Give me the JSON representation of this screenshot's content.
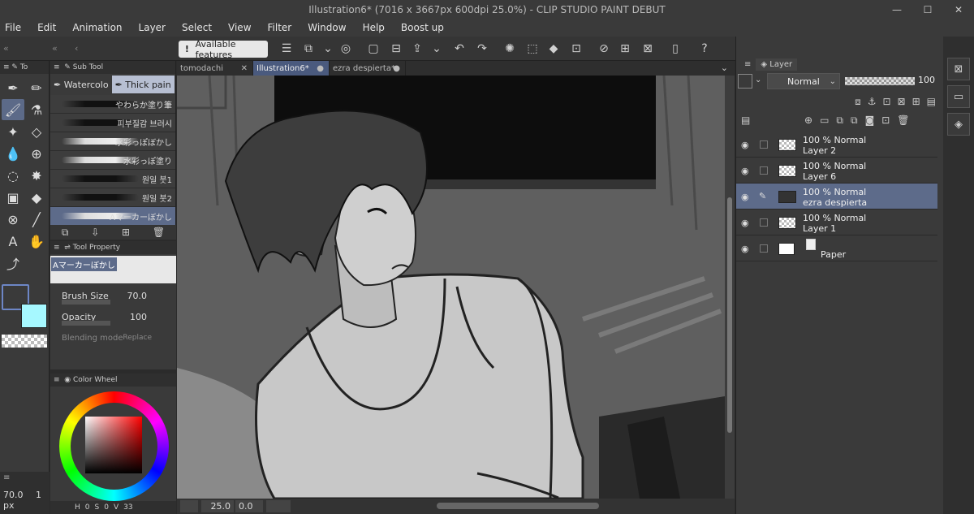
{
  "window": {
    "title": "Illustration6* (7016 x 3667px 600dpi 25.0%)  - CLIP STUDIO PAINT DEBUT",
    "minimize": "—",
    "maximize": "☐",
    "close": "✕"
  },
  "menu": [
    "File",
    "Edit",
    "Animation",
    "Layer",
    "Select",
    "View",
    "Filter",
    "Window",
    "Help",
    "Boost up"
  ],
  "toolbar": {
    "available_features": "Available features"
  },
  "tool_panel": {
    "title": "To"
  },
  "subtool": {
    "title": "Sub Tool",
    "tabs": [
      "Watercolo",
      "Thick pain"
    ],
    "brushes": [
      {
        "label": "やわらか塗り筆",
        "tone": "dark"
      },
      {
        "label": "피부질감 브러시",
        "tone": "dark"
      },
      {
        "label": "水彩っぽぼかし",
        "tone": "light"
      },
      {
        "label": "水彩っぽ塗り",
        "tone": "light"
      },
      {
        "label": "원일 붓1",
        "tone": "dark"
      },
      {
        "label": "원일 붓2",
        "tone": "dark"
      },
      {
        "label": "Aマーカーぼかし",
        "tone": "light"
      }
    ]
  },
  "tool_property": {
    "title": "Tool Property",
    "preset_name": "Aマーカーぼかし",
    "brush_size_label": "Brush Size",
    "brush_size": "70.0",
    "opacity_label": "Opacity",
    "opacity": "100",
    "blending_label": "Blending mode",
    "blending_value": "Replace"
  },
  "color_wheel": {
    "title": "Color Wheel",
    "footer": [
      "H",
      "0",
      "S",
      "0",
      "V",
      "33"
    ]
  },
  "brush_readout": {
    "size": "70.0",
    "unit": "px",
    "extra": "1"
  },
  "doc_tabs": [
    {
      "label": "tomodachi",
      "active": false
    },
    {
      "label": "Illustration6*",
      "active": true
    },
    {
      "label": "ezra despierta*",
      "active": false
    }
  ],
  "status": {
    "zoom": "25.0",
    "angle": "0.0"
  },
  "layer_panel": {
    "title": "Layer",
    "blend_mode": "Normal",
    "opacity": "100",
    "layers": [
      {
        "line1": "100 % Normal",
        "line2": "Layer 2",
        "selected": false,
        "kind": "raster"
      },
      {
        "line1": "100 % Normal",
        "line2": "Layer 6",
        "selected": false,
        "kind": "raster"
      },
      {
        "line1": "100 % Normal",
        "line2": "ezra despierta",
        "selected": true,
        "kind": "image"
      },
      {
        "line1": "100 % Normal",
        "line2": "Layer 1",
        "selected": false,
        "kind": "raster"
      },
      {
        "line1": "",
        "line2": "Paper",
        "selected": false,
        "kind": "paper"
      }
    ]
  },
  "colors": {
    "fg": "#3a3a3a",
    "bg": "#a6f8ff",
    "accent": "#5d6b8a"
  }
}
